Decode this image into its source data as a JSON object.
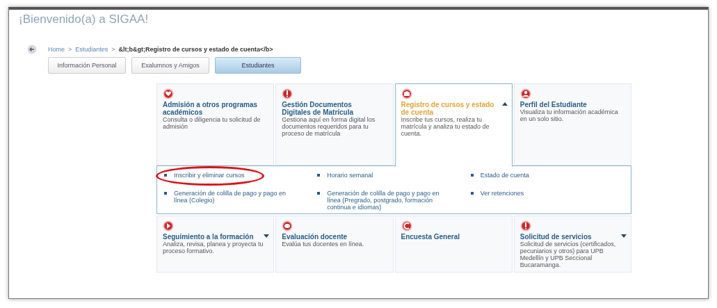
{
  "title": "¡Bienvenido(a) a SIGAA!",
  "breadcrumb": [
    {
      "label": "Home",
      "current": false
    },
    {
      "label": "Estudiantes",
      "current": false
    },
    {
      "label": "&lt;b&gt;Registro de cursos y estado de cuenta</b>",
      "current": true
    }
  ],
  "breadcrumb_separator": ">",
  "tabs": [
    {
      "label": "Información Personal",
      "selected": false
    },
    {
      "label": "Exalumnos y Amigos",
      "selected": false
    },
    {
      "label": "Estudiantes",
      "selected": true
    }
  ],
  "cards_top": [
    {
      "title": "Admisión a otros programas académicos",
      "description": "Consulta o diligencia tu solicitud de admisión",
      "expandable": false,
      "expanded": false
    },
    {
      "title": "Gestión Documentos Digitales de Matrícula",
      "description": "Gestiona aquí en forma digital los documentos requeridos para tu proceso de matrícula",
      "expandable": false,
      "expanded": false
    },
    {
      "title": "Registro de cursos y estado de cuenta",
      "description": "Inscribe tus cursos, realiza tu matrícula y analiza tu estado de cuenta.",
      "expandable": true,
      "expanded": true
    },
    {
      "title": "Perfil del Estudiante",
      "description": "Visualiza tu información académica en un solo sitio.",
      "expandable": false,
      "expanded": false
    }
  ],
  "submenu_links": [
    {
      "label": "Inscribir y eliminar cursos",
      "circled": true
    },
    {
      "label": "Horario semanal",
      "circled": false
    },
    {
      "label": "Estado de cuenta",
      "circled": false
    },
    {
      "label": "Generación de colilla de pago y pago en línea (Colegio)",
      "circled": false
    },
    {
      "label": "Generación de colilla de pago y pago en línea (Pregrado, postgrado, formación continua e idiomas)",
      "circled": false
    },
    {
      "label": "Ver retenciones",
      "circled": false
    }
  ],
  "cards_bottom": [
    {
      "title": "Seguimiento a la formación",
      "description": "Analiza, revisa, planea y proyecta tu proceso formativo.",
      "expandable": true,
      "expanded": false
    },
    {
      "title": "Evaluación docente",
      "description": "Evalúa tus docentes en línea.",
      "expandable": false,
      "expanded": false
    },
    {
      "title": "Encuesta General",
      "expandable": false,
      "expanded": false
    },
    {
      "title": "Solicitud de servicios",
      "description": "Solicitud de servicios (certificados, pecuniarios y otros) para UPB Medellín y UPB Seccional Bucaramanga.",
      "expandable": true,
      "expanded": false
    }
  ]
}
